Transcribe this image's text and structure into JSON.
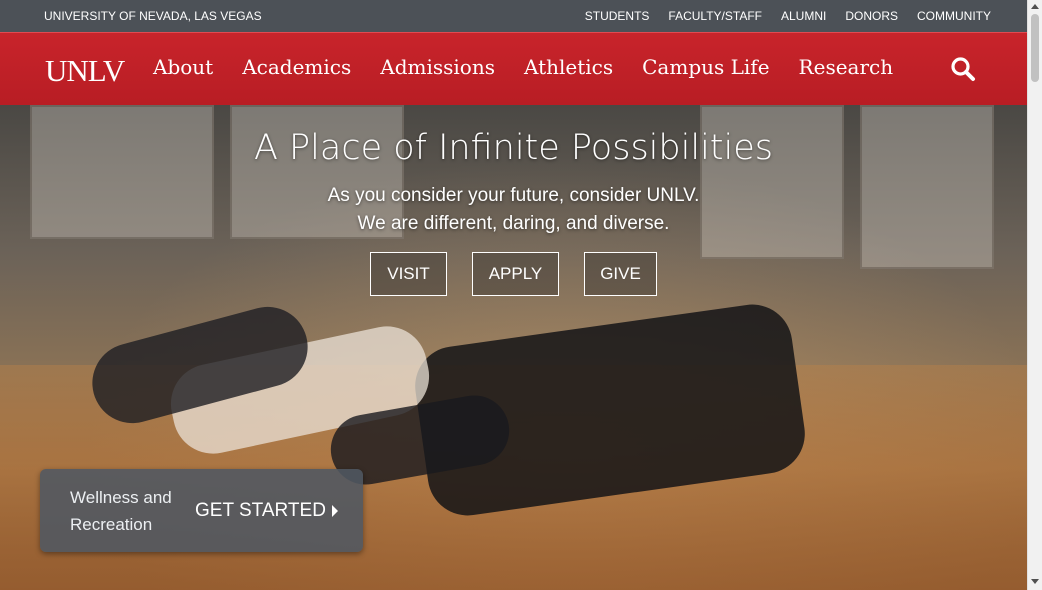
{
  "utility_bar": {
    "university_name": "UNIVERSITY OF NEVADA, LAS VEGAS",
    "links": [
      "STUDENTS",
      "FACULTY/STAFF",
      "ALUMNI",
      "DONORS",
      "COMMUNITY"
    ]
  },
  "main_nav": {
    "logo": "UNLV",
    "items": [
      "About",
      "Academics",
      "Admissions",
      "Athletics",
      "Campus Life",
      "Research"
    ],
    "search_icon": "search-icon"
  },
  "hero": {
    "title": "A Place of Infinite Possibilities",
    "subtitle_line1": "As you consider your future, consider UNLV.",
    "subtitle_line2": "We are different, daring, and diverse.",
    "buttons": [
      "VISIT",
      "APPLY",
      "GIVE"
    ]
  },
  "promo": {
    "label": "Wellness and Recreation",
    "cta": "GET STARTED"
  },
  "colors": {
    "utility_bg": "#4c5157",
    "nav_red": "#c8242b",
    "promo_bg": "#505862"
  }
}
